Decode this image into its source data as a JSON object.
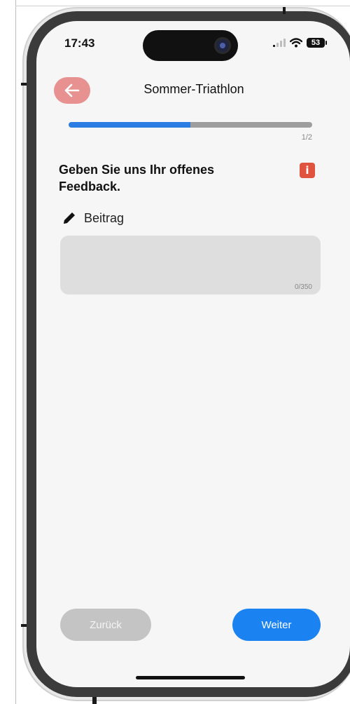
{
  "status_bar": {
    "time": "17:43",
    "battery": "53"
  },
  "header": {
    "title": "Sommer-Triathlon"
  },
  "progress": {
    "label": "1/2",
    "fraction": 0.5
  },
  "question": {
    "text": "Geben Sie uns Ihr offenes Feedback.",
    "info_label": "i"
  },
  "field": {
    "label": "Beitrag",
    "value": "",
    "counter": "0/350"
  },
  "footer": {
    "back_label": "Zurück",
    "next_label": "Weiter"
  },
  "icons": {
    "back": "arrow-left-icon",
    "info": "info-icon",
    "edit": "pencil-icon"
  },
  "colors": {
    "primary": "#1b83f1",
    "back_button": "#e79191",
    "progress_fill": "#2b7de4",
    "info_badge": "#e0533e",
    "disabled_button": "#c4c4c4"
  }
}
